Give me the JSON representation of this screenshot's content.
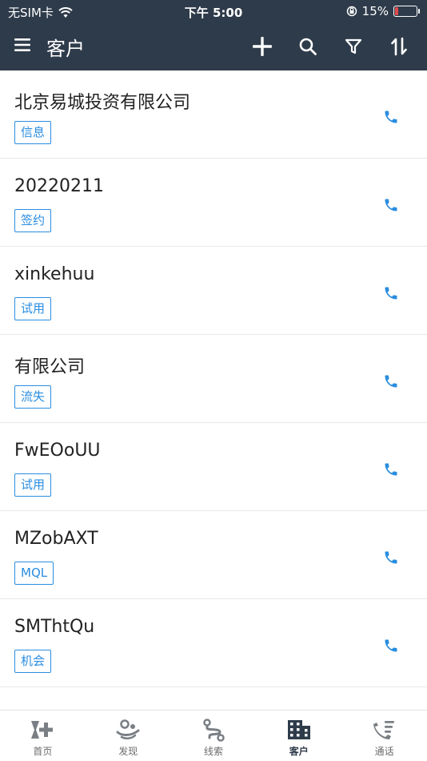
{
  "status_bar": {
    "carrier": "无SIM卡",
    "time": "下午 5:00",
    "battery": "15%",
    "battery_level": 0.15
  },
  "nav": {
    "title": "客户"
  },
  "customers": [
    {
      "name": "北京易城投资有限公司",
      "tag": "信息"
    },
    {
      "name": "20220211",
      "tag": "签约"
    },
    {
      "name": "xinkehuu",
      "tag": "试用"
    },
    {
      "name": "有限公司",
      "tag": "流失"
    },
    {
      "name": "FwEOoUU",
      "tag": "试用"
    },
    {
      "name": "MZobAXT",
      "tag": "MQL"
    },
    {
      "name": "SMThtQu",
      "tag": "机会"
    }
  ],
  "tabs": [
    {
      "label": "首页",
      "icon": "home-icon"
    },
    {
      "label": "发现",
      "icon": "discover-icon"
    },
    {
      "label": "线索",
      "icon": "leads-icon"
    },
    {
      "label": "客户",
      "icon": "building-icon",
      "active": true
    },
    {
      "label": "通话",
      "icon": "call-log-icon"
    }
  ],
  "colors": {
    "header_bg": "#2e3b4a",
    "accent": "#2a8de0",
    "battery_low": "#e24a4a"
  }
}
